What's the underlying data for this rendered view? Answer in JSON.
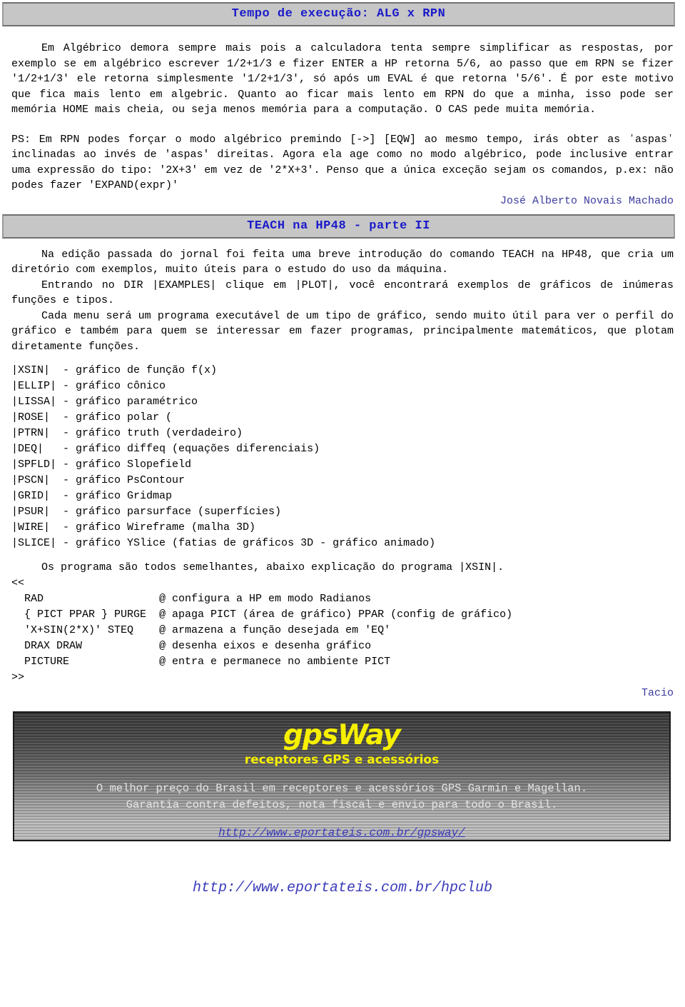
{
  "section1": {
    "title": "Tempo de execução: ALG x RPN",
    "paragraph1": "Em Algébrico demora sempre mais pois a calculadora tenta sempre simplificar as respostas, por exemplo se em algébrico escrever 1/2+1/3 e fizer ENTER a HP retorna 5/6, ao passo que em RPN se fizer '1/2+1/3' ele retorna simplesmente '1/2+1/3', só após um EVAL é que retorna '5/6'. É por este motivo que fica mais lento em algebric. Quanto ao ficar mais lento em RPN do que a minha, isso pode ser memória HOME mais cheia, ou seja menos memória para a computação. O CAS pede muita memória.",
    "paragraph2": "PS: Em RPN podes forçar o modo algébrico premindo [->] [EQW] ao mesmo tempo, irás obter as ʼaspasʼ inclinadas ao invés de 'aspas' direitas. Agora ela age como no modo algébrico, pode inclusive entrar uma expressão do tipo: '2X+3' em vez de '2*X+3'. Penso que a única exceção sejam os comandos, p.ex: não  podes fazer 'EXPAND(expr)'",
    "signature": "José Alberto Novais Machado"
  },
  "section2": {
    "title": "TEACH na HP48 - parte II",
    "paragraph1": "Na edição passada do jornal foi feita uma breve introdução do comando TEACH na HP48, que cria um diretório com exemplos, muito úteis para o estudo do uso da máquina.",
    "paragraph2": "Entrando no DIR |EXAMPLES| clique em |PLOT|, você encontrará exemplos de gráficos de inúmeras funções e tipos.",
    "paragraph3": "Cada menu será um programa executável de um tipo de gráfico, sendo muito útil para ver o perfil do gráfico e também para quem se interessar em fazer programas, principalmente matemáticos, que plotam diretamente funções.",
    "plot_programs": [
      "|XSIN|  - gráfico de função f(x)",
      "|ELLIP| - gráfico cônico",
      "|LISSA| - gráfico paramétrico",
      "|ROSE|  - gráfico polar (",
      "|PTRN|  - gráfico truth (verdadeiro)",
      "|DEQ|   - gráfico diffeq (equações diferenciais)",
      "|SPFLD| - gráfico Slopefield",
      "|PSCN|  - gráfico PsContour",
      "|GRID|  - gráfico Gridmap",
      "|PSUR|  - gráfico parsurface (superfícies)",
      "|WIRE|  - gráfico Wireframe (malha 3D)",
      "|SLICE| - gráfico YSlice (fatias de gráficos 3D - gráfico animado)"
    ],
    "paragraph4": "Os programa são todos semelhantes, abaixo explicação do programa |XSIN|.",
    "code_lines": [
      "<<",
      "  RAD                  @ configura a HP em modo Radianos",
      "  { PICT PPAR } PURGE  @ apaga PICT (área de gráfico) PPAR (config de gráfico)",
      "  'X+SIN(2*X)' STEQ    @ armazena a função desejada em 'EQ'",
      "  DRAX DRAW            @ desenha eixos e desenha gráfico",
      "  PICTURE              @ entra e permanece no ambiente PICT",
      ">>"
    ],
    "signature": "Tacio"
  },
  "banner": {
    "logo": "gpsWay",
    "tagline": "receptores GPS e acessórios",
    "line1": "O melhor preço do Brasil em receptores e acessórios GPS Garmin e Magellan.",
    "line2": "Garantia contra defeitos, nota fiscal e envio para todo o Brasil.",
    "link": "http://www.eportateis.com.br/gpsway/"
  },
  "footer": {
    "link": "http://www.eportateis.com.br/hpclub"
  },
  "colors": {
    "title_blue": "#1a1aca",
    "signature_blue": "#3b3b9e",
    "link_blue": "#3b3bbb",
    "titlebar_bg": "#c6c6c6",
    "logo_yellow": "#f7f000"
  }
}
